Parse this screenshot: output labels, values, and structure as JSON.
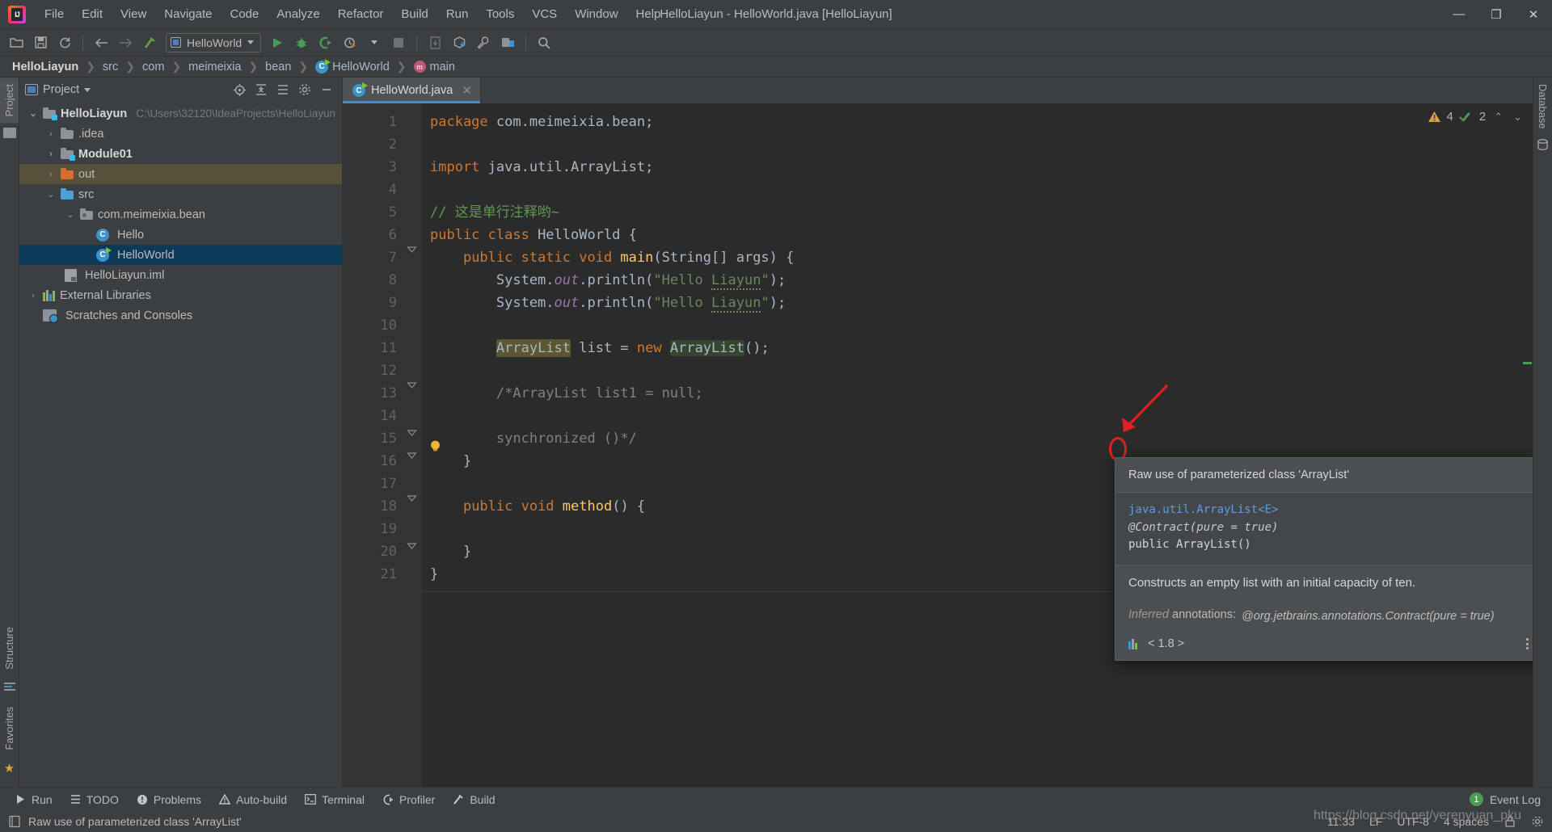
{
  "window": {
    "title": "HelloLiayun - HelloWorld.java [HelloLiayun]",
    "minimize": "—",
    "maximize": "❐",
    "close": "✕"
  },
  "menubar": [
    {
      "label": "File"
    },
    {
      "label": "Edit"
    },
    {
      "label": "View"
    },
    {
      "label": "Navigate"
    },
    {
      "label": "Code"
    },
    {
      "label": "Analyze"
    },
    {
      "label": "Refactor"
    },
    {
      "label": "Build"
    },
    {
      "label": "Run"
    },
    {
      "label": "Tools"
    },
    {
      "label": "VCS"
    },
    {
      "label": "Window"
    },
    {
      "label": "Help"
    }
  ],
  "toolbar": {
    "run_config": "HelloWorld",
    "icons": [
      "open-folder-icon",
      "save-icon",
      "sync-icon",
      "back-arrow-icon",
      "forward-arrow-icon",
      "build-hammer-icon",
      "run-icon",
      "debug-icon",
      "run-coverage-icon",
      "profile-icon",
      "stop-icon",
      "update-app-icon",
      "install-apk-icon",
      "wrench-icon",
      "avd-manager-icon",
      "sdk-manager-icon",
      "search-icon"
    ]
  },
  "breadcrumb": [
    {
      "label": "HelloLiayun",
      "bold": true
    },
    {
      "label": "src",
      "bold": false
    },
    {
      "label": "com",
      "bold": false
    },
    {
      "label": "meimeixia",
      "bold": false
    },
    {
      "label": "bean",
      "bold": false
    },
    {
      "label": "HelloWorld",
      "bold": false,
      "icon": "java-class-icon"
    },
    {
      "label": "main",
      "bold": false,
      "icon": "method-icon"
    }
  ],
  "sidebar_left": {
    "tabs": [
      {
        "label": "Project",
        "active": true
      },
      {
        "label": "Structure",
        "active": false
      },
      {
        "label": "Favorites",
        "active": false
      }
    ]
  },
  "sidebar_right": {
    "tabs": [
      {
        "label": "Database",
        "active": false
      }
    ]
  },
  "project_panel": {
    "title": "Project",
    "header_icons": [
      "locate-icon",
      "expand-all-icon",
      "collapse-all-icon",
      "gear-icon",
      "hide-icon"
    ],
    "tree": [
      {
        "label": "HelloLiayun",
        "path": "C:\\Users\\32120\\IdeaProjects\\HelloLiayun",
        "indent": 0,
        "arrow": "⌄",
        "icon": "project-folder-icon",
        "bold": true,
        "state": "normal"
      },
      {
        "label": ".idea",
        "path": "",
        "indent": 1,
        "arrow": "›",
        "icon": "folder-grey-icon",
        "bold": false,
        "state": "normal"
      },
      {
        "label": "Module01",
        "path": "",
        "indent": 1,
        "arrow": "›",
        "icon": "module-folder-icon",
        "bold": true,
        "state": "normal"
      },
      {
        "label": "out",
        "path": "",
        "indent": 1,
        "arrow": "›",
        "icon": "folder-orange-icon",
        "bold": false,
        "state": "highlight"
      },
      {
        "label": "src",
        "path": "",
        "indent": 1,
        "arrow": "⌄",
        "icon": "folder-blue-icon",
        "bold": false,
        "state": "normal"
      },
      {
        "label": "com.meimeixia.bean",
        "path": "",
        "indent": 2,
        "arrow": "⌄",
        "icon": "package-icon",
        "bold": false,
        "state": "normal"
      },
      {
        "label": "Hello",
        "path": "",
        "indent": 3,
        "arrow": "",
        "icon": "java-class-icon",
        "bold": false,
        "state": "normal"
      },
      {
        "label": "HelloWorld",
        "path": "",
        "indent": 3,
        "arrow": "",
        "icon": "java-runnable-class-icon",
        "bold": false,
        "state": "selected"
      },
      {
        "label": "HelloLiayun.iml",
        "path": "",
        "indent": 2,
        "arrow": "",
        "icon": "iml-file-icon",
        "bold": false,
        "state": "normal"
      },
      {
        "label": "External Libraries",
        "path": "",
        "indent": 0,
        "arrow": "›",
        "icon": "libraries-icon",
        "bold": false,
        "state": "normal"
      },
      {
        "label": "Scratches and Consoles",
        "path": "",
        "indent": 0,
        "arrow": "",
        "icon": "scratches-icon",
        "bold": false,
        "state": "normal"
      }
    ]
  },
  "editor": {
    "tab": {
      "label": "HelloWorld.java",
      "icon": "java-runnable-class-icon",
      "close": "✕"
    },
    "inspection": {
      "warnings": "4",
      "checks": "2",
      "up": "⌃",
      "down": "⌄"
    },
    "lines": [
      {
        "n": "1",
        "run": false
      },
      {
        "n": "2",
        "run": false
      },
      {
        "n": "3",
        "run": false
      },
      {
        "n": "4",
        "run": false
      },
      {
        "n": "5",
        "run": false
      },
      {
        "n": "6",
        "run": true
      },
      {
        "n": "7",
        "run": true
      },
      {
        "n": "8",
        "run": false
      },
      {
        "n": "9",
        "run": false
      },
      {
        "n": "10",
        "run": false
      },
      {
        "n": "11",
        "run": false
      },
      {
        "n": "12",
        "run": false
      },
      {
        "n": "13",
        "run": false
      },
      {
        "n": "14",
        "run": false
      },
      {
        "n": "15",
        "run": false
      },
      {
        "n": "16",
        "run": false
      },
      {
        "n": "17",
        "run": false
      },
      {
        "n": "18",
        "run": false
      },
      {
        "n": "19",
        "run": false
      },
      {
        "n": "20",
        "run": false
      },
      {
        "n": "21",
        "run": false
      }
    ],
    "code": {
      "l1": "package com.meimeixia.bean;",
      "l3": "import java.util.ArrayList;",
      "l5": "// 这是单行注释哟~",
      "l6": "public class HelloWorld {",
      "l7": "    public static void main(String[] args) {",
      "l8": "        System.out.println(\"Hello Liayun\");",
      "l9": "        System.out.println(\"Hello Liayun\");",
      "l11": "        ArrayList list = new ArrayList();",
      "l13": "        /*ArrayList list1 = null;",
      "l15": "        synchronized ()*/",
      "l16": "    }",
      "l18": "    public void method() {",
      "l20": "    }",
      "l21": "}"
    }
  },
  "popup": {
    "title": "Raw use of parameterized class 'ArrayList'",
    "signature_type": "java.util.ArrayList<E>",
    "signature_annotation": "@Contract(pure = true)",
    "signature_decl": "public ArrayList()",
    "description": "Constructs an empty list with an initial capacity of ten.",
    "inferred_label": "Inferred",
    "inferred_label2": " annotations:",
    "inferred_value": "@org.jetbrains.annotations.Contract(pure = true)",
    "jdk": "< 1.8 >",
    "kebab_icon": "more-options-icon"
  },
  "bottom_tabs": [
    {
      "label": "Run",
      "icon": "run-icon"
    },
    {
      "label": "TODO",
      "icon": "todo-icon"
    },
    {
      "label": "Problems",
      "icon": "problems-icon"
    },
    {
      "label": "Auto-build",
      "icon": "warning-icon"
    },
    {
      "label": "Terminal",
      "icon": "terminal-icon"
    },
    {
      "label": "Profiler",
      "icon": "profiler-icon"
    },
    {
      "label": "Build",
      "icon": "build-hammer-icon"
    }
  ],
  "event_log": {
    "count": "1",
    "label": "Event Log"
  },
  "statusbar": {
    "message": "Raw use of parameterized class 'ArrayList'",
    "message_icon": "info-icon",
    "position": "11:33",
    "line_sep": "LF",
    "encoding": "UTF-8",
    "indent": "4 spaces",
    "lock_icon": "lock-icon",
    "gear_icon": "gear-icon"
  },
  "watermark": "https://blog.csdn.net/yerenyuan_pku",
  "colors": {
    "accent": "#4a88c7",
    "selection": "#0d3a58",
    "warning": "#d9a343",
    "ok": "#499c54",
    "red": "#e02020"
  }
}
